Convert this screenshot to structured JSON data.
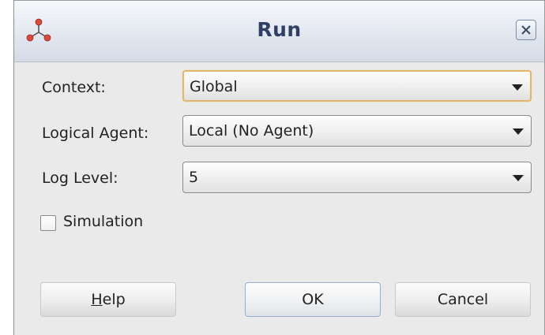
{
  "dialog": {
    "title": "Run",
    "icon": "three-nodes-icon",
    "close_icon": "close-icon"
  },
  "form": {
    "context": {
      "label": "Context:",
      "value": "Global",
      "focused": true
    },
    "logical_agent": {
      "label": "Logical Agent:",
      "value": "Local (No Agent)"
    },
    "log_level": {
      "label": "Log Level:",
      "value": "5"
    },
    "simulation": {
      "label": "Simulation",
      "checked": false
    }
  },
  "buttons": {
    "help_mnemonic": "H",
    "help_rest": "elp",
    "ok": "OK",
    "cancel": "Cancel"
  },
  "colors": {
    "title_text": "#2f3f66",
    "focus_border": "#e2b66b",
    "dialog_bg": "#eaeaea",
    "icon_red": "#d94a3a"
  }
}
